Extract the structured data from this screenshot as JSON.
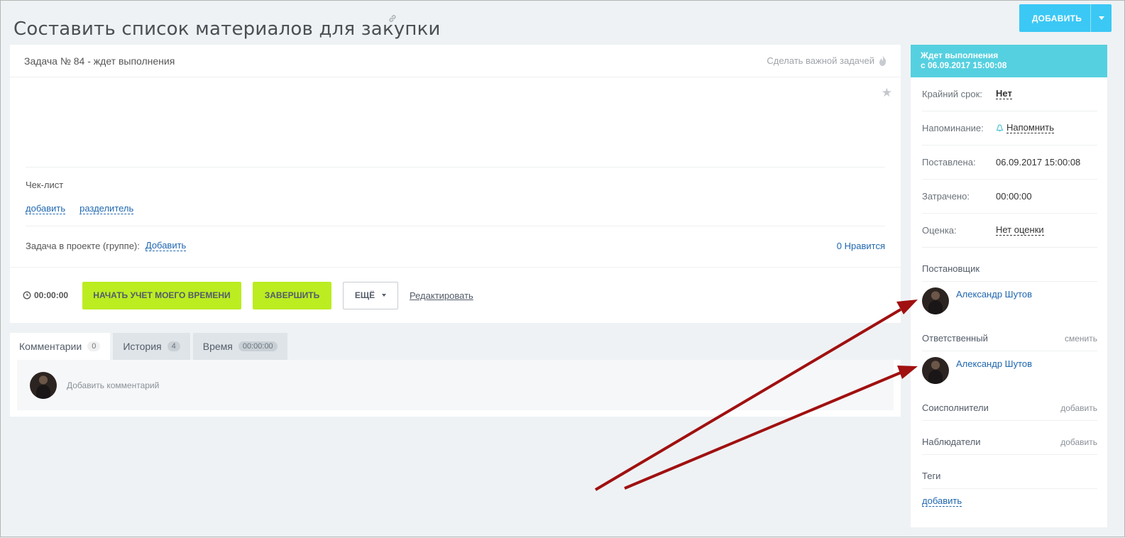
{
  "page": {
    "title": "Составить список материалов для закупки"
  },
  "header": {
    "add_button": "ДОБАВИТЬ"
  },
  "task": {
    "status_line": "Задача № 84 - ждет выполнения",
    "make_important": "Сделать важной задачей",
    "checklist_title": "Чек-лист",
    "checklist_add": "добавить",
    "checklist_separator": "разделитель",
    "project_label": "Задача в проекте (группе):",
    "project_add": "Добавить",
    "likes": "0 Нравится",
    "timer": "00:00:00",
    "start_button": "НАЧАТЬ УЧЕТ МОЕГО ВРЕМЕНИ",
    "finish_button": "ЗАВЕРШИТЬ",
    "more_button": "ЕЩЁ",
    "edit_link": "Редактировать"
  },
  "tabs": [
    {
      "label": "Комментарии",
      "count": "0"
    },
    {
      "label": "История",
      "count": "4"
    },
    {
      "label": "Время",
      "count": "00:00:00"
    }
  ],
  "comments": {
    "placeholder": "Добавить комментарий"
  },
  "sidebar": {
    "status_title": "Ждет выполнения",
    "status_since": "с 06.09.2017 15:00:08",
    "deadline_label": "Крайний срок:",
    "deadline_value": "Нет",
    "reminder_label": "Напоминание:",
    "reminder_value": "Напомнить",
    "created_label": "Поставлена:",
    "created_value": "06.09.2017 15:00:08",
    "spent_label": "Затрачено:",
    "spent_value": "00:00:00",
    "rating_label": "Оценка:",
    "rating_value": "Нет оценки",
    "creator_title": "Постановщик",
    "creator_name": "Александр Шутов",
    "responsible_title": "Ответственный",
    "responsible_change": "сменить",
    "responsible_name": "Александр Шутов",
    "coexecutors_title": "Соисполнители",
    "coexecutors_add": "добавить",
    "observers_title": "Наблюдатели",
    "observers_add": "добавить",
    "tags_title": "Теги",
    "tags_add": "добавить"
  },
  "colors": {
    "accent_blue": "#3bc8f5",
    "status_header": "#55d0e0",
    "green_button": "#bbed21",
    "annotation_arrow": "#a01010"
  }
}
